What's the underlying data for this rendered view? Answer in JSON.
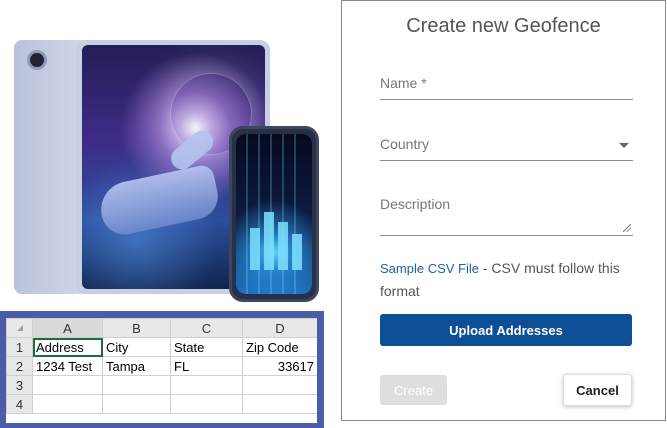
{
  "spreadsheet": {
    "columns": [
      "A",
      "B",
      "C",
      "D"
    ],
    "rows": [
      {
        "num": "1",
        "cells": [
          "Address",
          "City",
          "State",
          "Zip Code"
        ]
      },
      {
        "num": "2",
        "cells": [
          "1234 Test",
          "Tampa",
          "FL",
          "33617"
        ]
      },
      {
        "num": "3",
        "cells": [
          "",
          "",
          "",
          ""
        ]
      },
      {
        "num": "4",
        "cells": [
          "",
          "",
          "",
          ""
        ]
      }
    ]
  },
  "dialog": {
    "title": "Create new Geofence",
    "name_label": "Name *",
    "country_label": "Country",
    "description_label": "Description",
    "sample_link": "Sample CSV File",
    "help_text": " - CSV must follow this format",
    "upload_label": "Upload Addresses",
    "create_label": "Create",
    "cancel_label": "Cancel"
  },
  "colors": {
    "primary": "#0d4f97",
    "link": "#1f5ea8",
    "sheet_frame": "#4b5da7",
    "selection": "#1d6e3f"
  }
}
